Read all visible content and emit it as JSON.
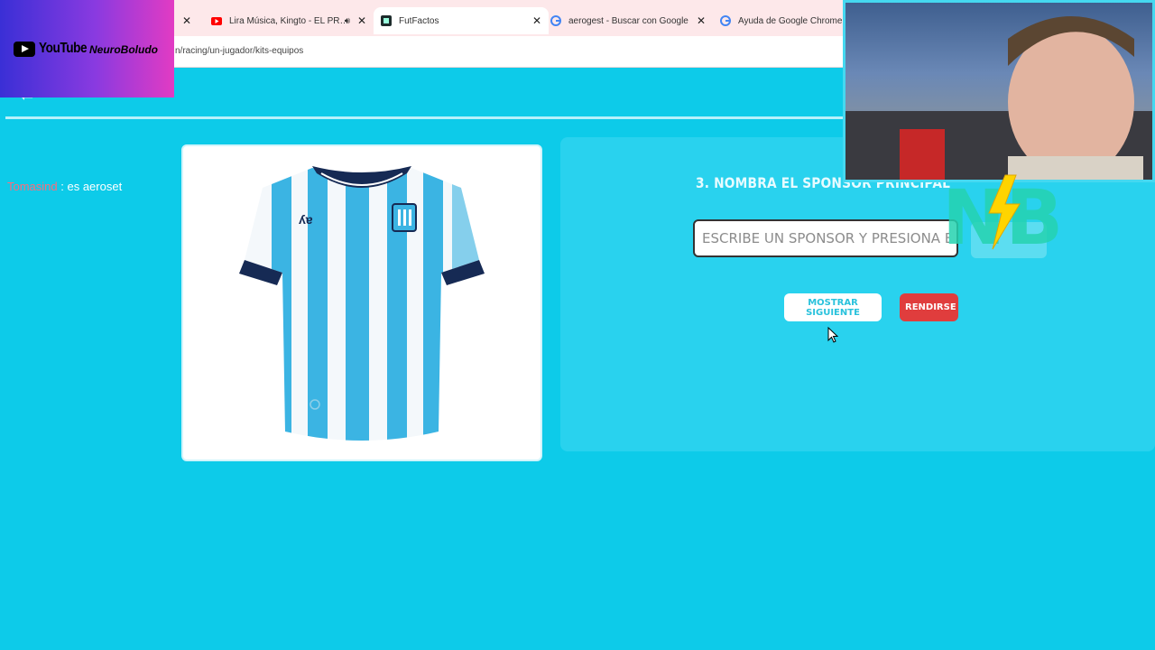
{
  "browser": {
    "tabs": [
      {
        "title": "Lira Música, Kingto - EL PR…",
        "icon": "youtube-icon",
        "audio": true
      },
      {
        "title": "FutFactos",
        "icon": "futfactos-icon",
        "active": true
      },
      {
        "title": "aerogest - Buscar con Google",
        "icon": "google-icon"
      },
      {
        "title": "Ayuda de Google Chrome",
        "icon": "google-icon"
      }
    ],
    "url": "n/racing/un-jugador/kits-equipos"
  },
  "overlay": {
    "youtube_word": "YouTube",
    "channel": "NeuroBoludo",
    "chat": {
      "user": "Tomasind",
      "separator": " : ",
      "message": "es aeroset"
    },
    "logo_text": "NB"
  },
  "quiz": {
    "question": "3. NOMBRA EL SPONSOR PRINCIPAL",
    "input_placeholder": "ESCRIBE UN SPONSOR Y PRESIONA ENTER",
    "next_label": "MOSTRAR SIGUIENTE",
    "giveup_label": "RENDIRSE"
  },
  "colors": {
    "page_bg": "#0dcbe9",
    "panel_bg": "#29d2ee",
    "giveup": "#e03d3d",
    "jersey_sky": "#3bb4e3",
    "jersey_navy": "#162a54"
  }
}
